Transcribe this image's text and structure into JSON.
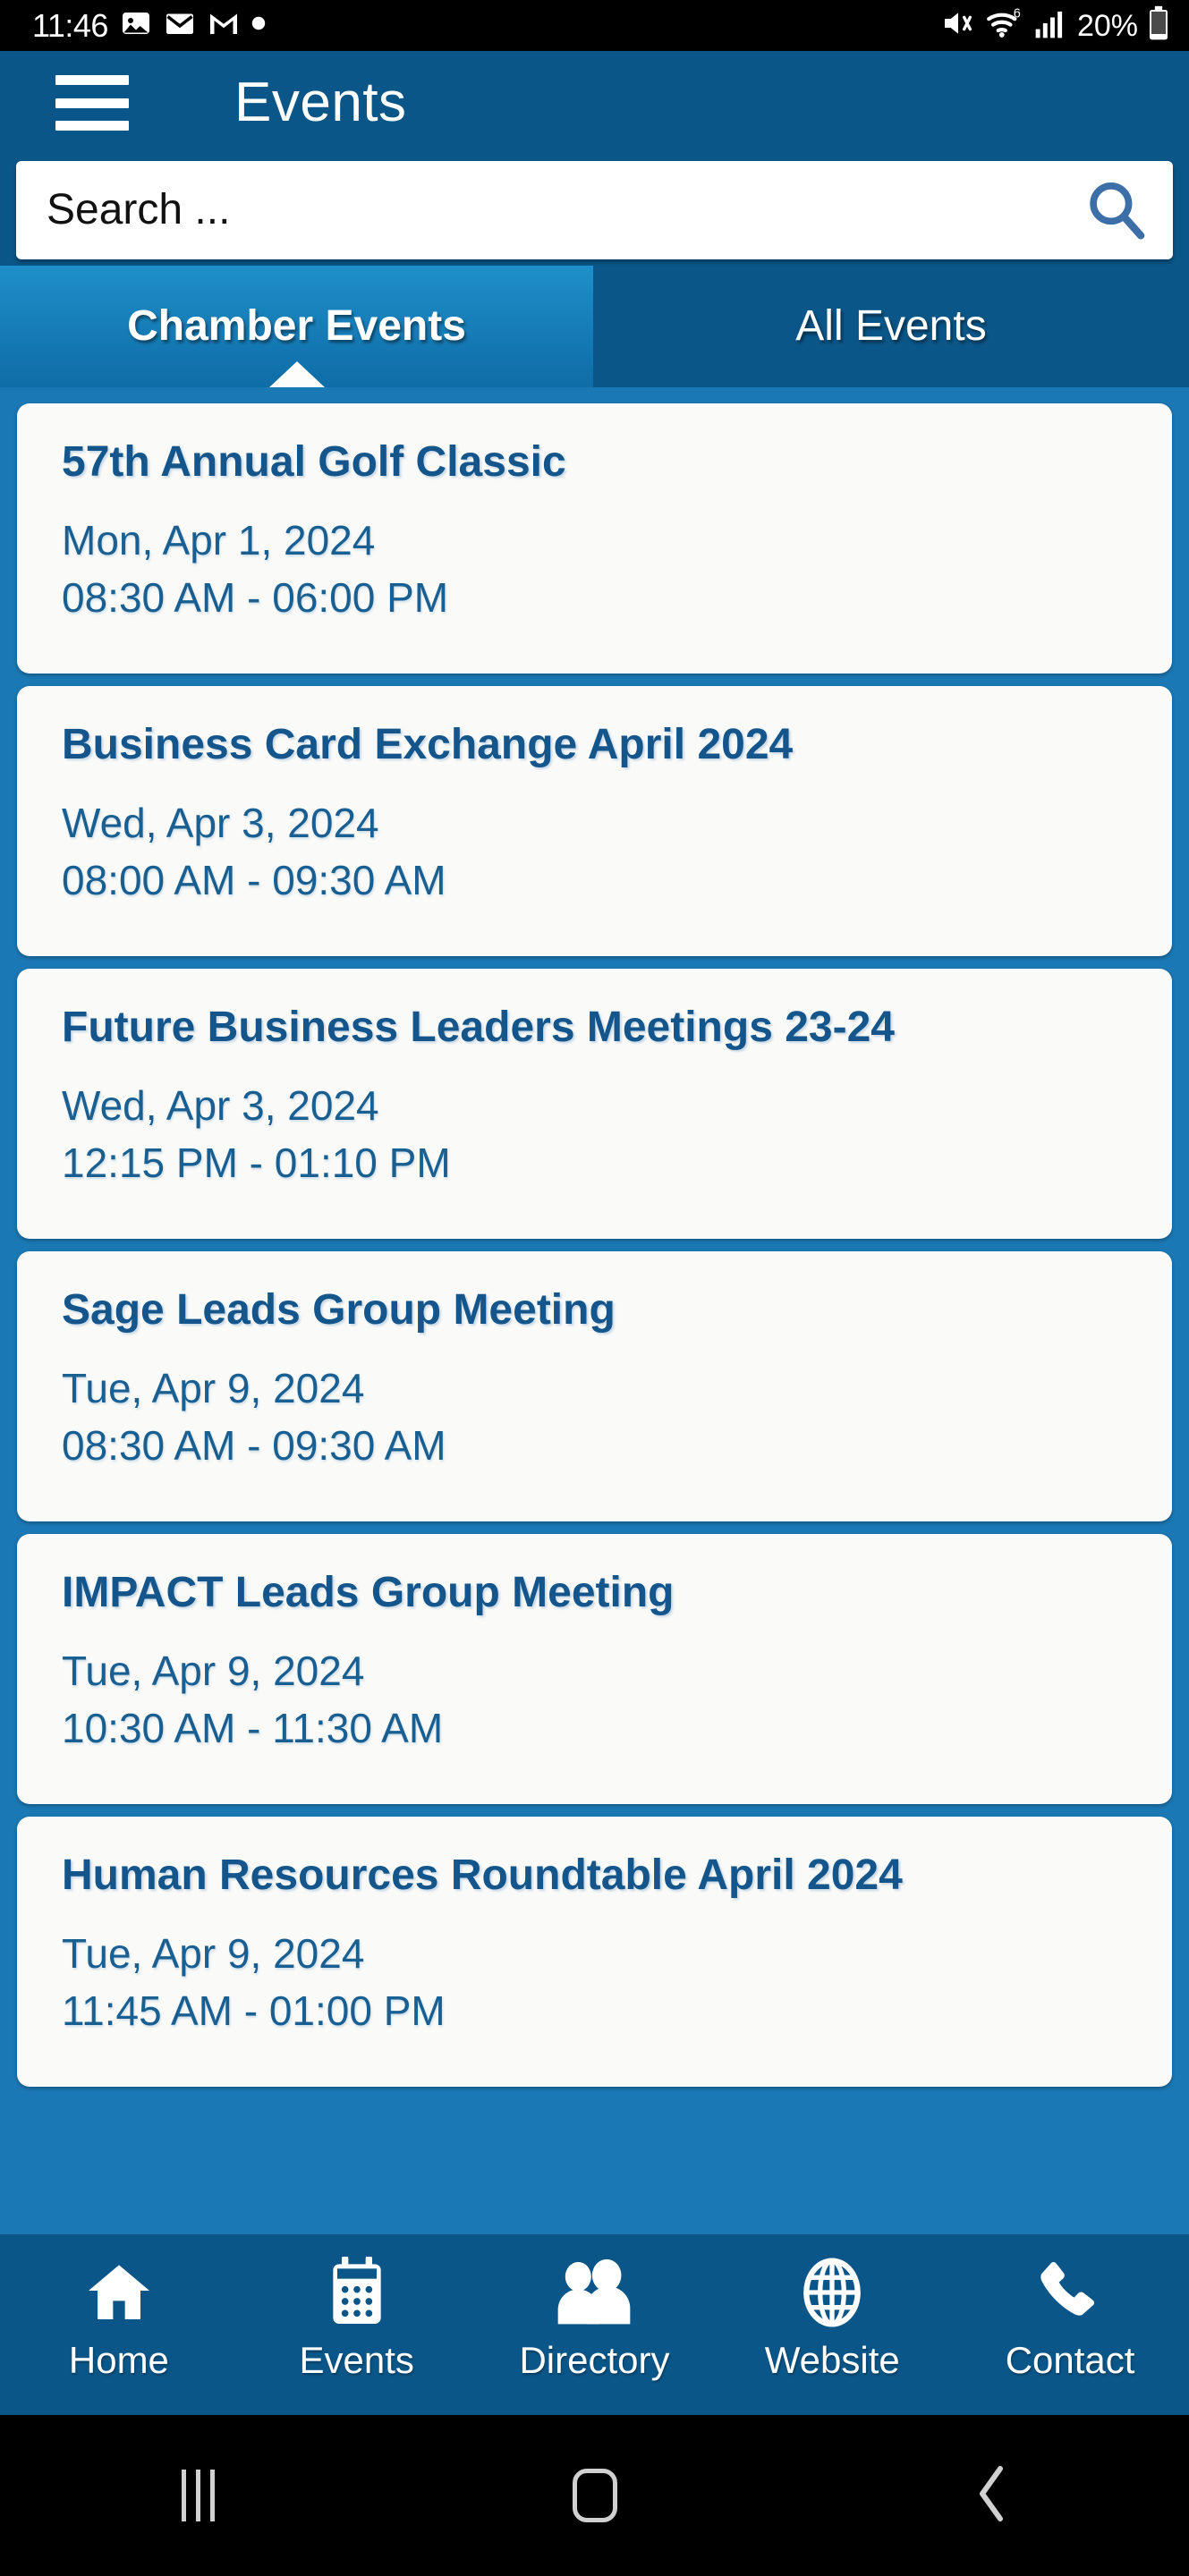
{
  "status_bar": {
    "time": "11:46",
    "battery_percent": "20%",
    "left_icons": [
      "photos-icon",
      "mail-icon",
      "gmail-icon",
      "dot-icon"
    ],
    "right_icons": [
      "mute-icon",
      "wifi-6-icon",
      "cellular-signal-icon",
      "battery-icon"
    ]
  },
  "app_bar": {
    "menu_icon": "hamburger-menu-icon",
    "title": "Events"
  },
  "search": {
    "placeholder": "Search ...",
    "icon": "search-icon"
  },
  "tabs": [
    {
      "label": "Chamber Events",
      "active": true
    },
    {
      "label": "All Events",
      "active": false
    }
  ],
  "events": [
    {
      "title": "57th Annual Golf Classic",
      "date": "Mon, Apr 1, 2024",
      "time": "08:30 AM - 06:00 PM"
    },
    {
      "title": "Business Card Exchange April 2024",
      "date": "Wed, Apr 3, 2024",
      "time": "08:00 AM - 09:30 AM"
    },
    {
      "title": "Future Business Leaders Meetings 23-24",
      "date": "Wed, Apr 3, 2024",
      "time": "12:15 PM - 01:10 PM"
    },
    {
      "title": "Sage Leads Group Meeting",
      "date": "Tue, Apr 9, 2024",
      "time": "08:30 AM - 09:30 AM"
    },
    {
      "title": "IMPACT Leads Group Meeting",
      "date": "Tue, Apr 9, 2024",
      "time": "10:30 AM - 11:30 AM"
    },
    {
      "title": "Human Resources Roundtable April 2024",
      "date": "Tue, Apr 9, 2024",
      "time": "11:45 AM - 01:00 PM"
    }
  ],
  "bottom_nav": [
    {
      "label": "Home",
      "icon": "home-icon"
    },
    {
      "label": "Events",
      "icon": "calendar-icon"
    },
    {
      "label": "Directory",
      "icon": "people-icon"
    },
    {
      "label": "Website",
      "icon": "globe-icon"
    },
    {
      "label": "Contact",
      "icon": "phone-icon"
    }
  ],
  "system_nav": [
    {
      "icon": "recents-icon"
    },
    {
      "icon": "home-square-icon"
    },
    {
      "icon": "back-chevron-icon"
    }
  ],
  "colors": {
    "header_blue": "#0b5688",
    "list_blue": "#1a78b4",
    "active_tab_blue": "#1e8fca",
    "card_bg": "#fafaf8",
    "title_blue": "#14568c"
  }
}
